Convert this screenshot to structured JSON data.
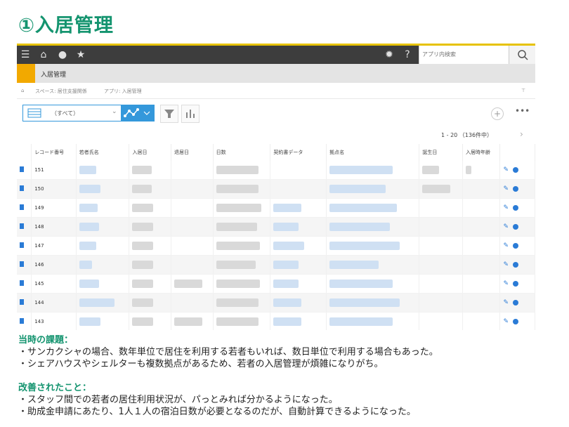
{
  "slide": {
    "title": "①入居管理",
    "problem_heading": "当時の課題：",
    "problems": [
      "・サンカクシャの場合、数年単位で居住を利用する若者もいれば、数日単位で利用する場合もあった。",
      "・シェアハウスやシェルターも複数拠点があるため、若者の入居管理が煩雑になりがち。"
    ],
    "improve_heading": "改善されたこと：",
    "improvements": [
      "・スタッフ間での若者の居住利用状況が、パっとみれば分かるようになった。",
      "・助成金申請にあたり、1人１人の宿泊日数が必要となるのだが、自動計算できるようになった。"
    ]
  },
  "app": {
    "search_placeholder": "アプリ内検索",
    "app_name": "入居管理",
    "breadcrumb_space": "スペース: 居住支援関係",
    "breadcrumb_app": "アプリ: 入居管理",
    "view_label": "（すべて）",
    "pager": "1 - 20 （136件中）",
    "columns": [
      "レコード番号",
      "若者氏名",
      "入居日",
      "退居日",
      "日数",
      "契約書データ",
      "拠点名",
      "誕生日",
      "入居時年齢"
    ],
    "rows": [
      "151",
      "150",
      "149",
      "148",
      "147",
      "146",
      "145",
      "144",
      "143"
    ],
    "accent_color": "#3498db",
    "title_color": "#14946f"
  }
}
